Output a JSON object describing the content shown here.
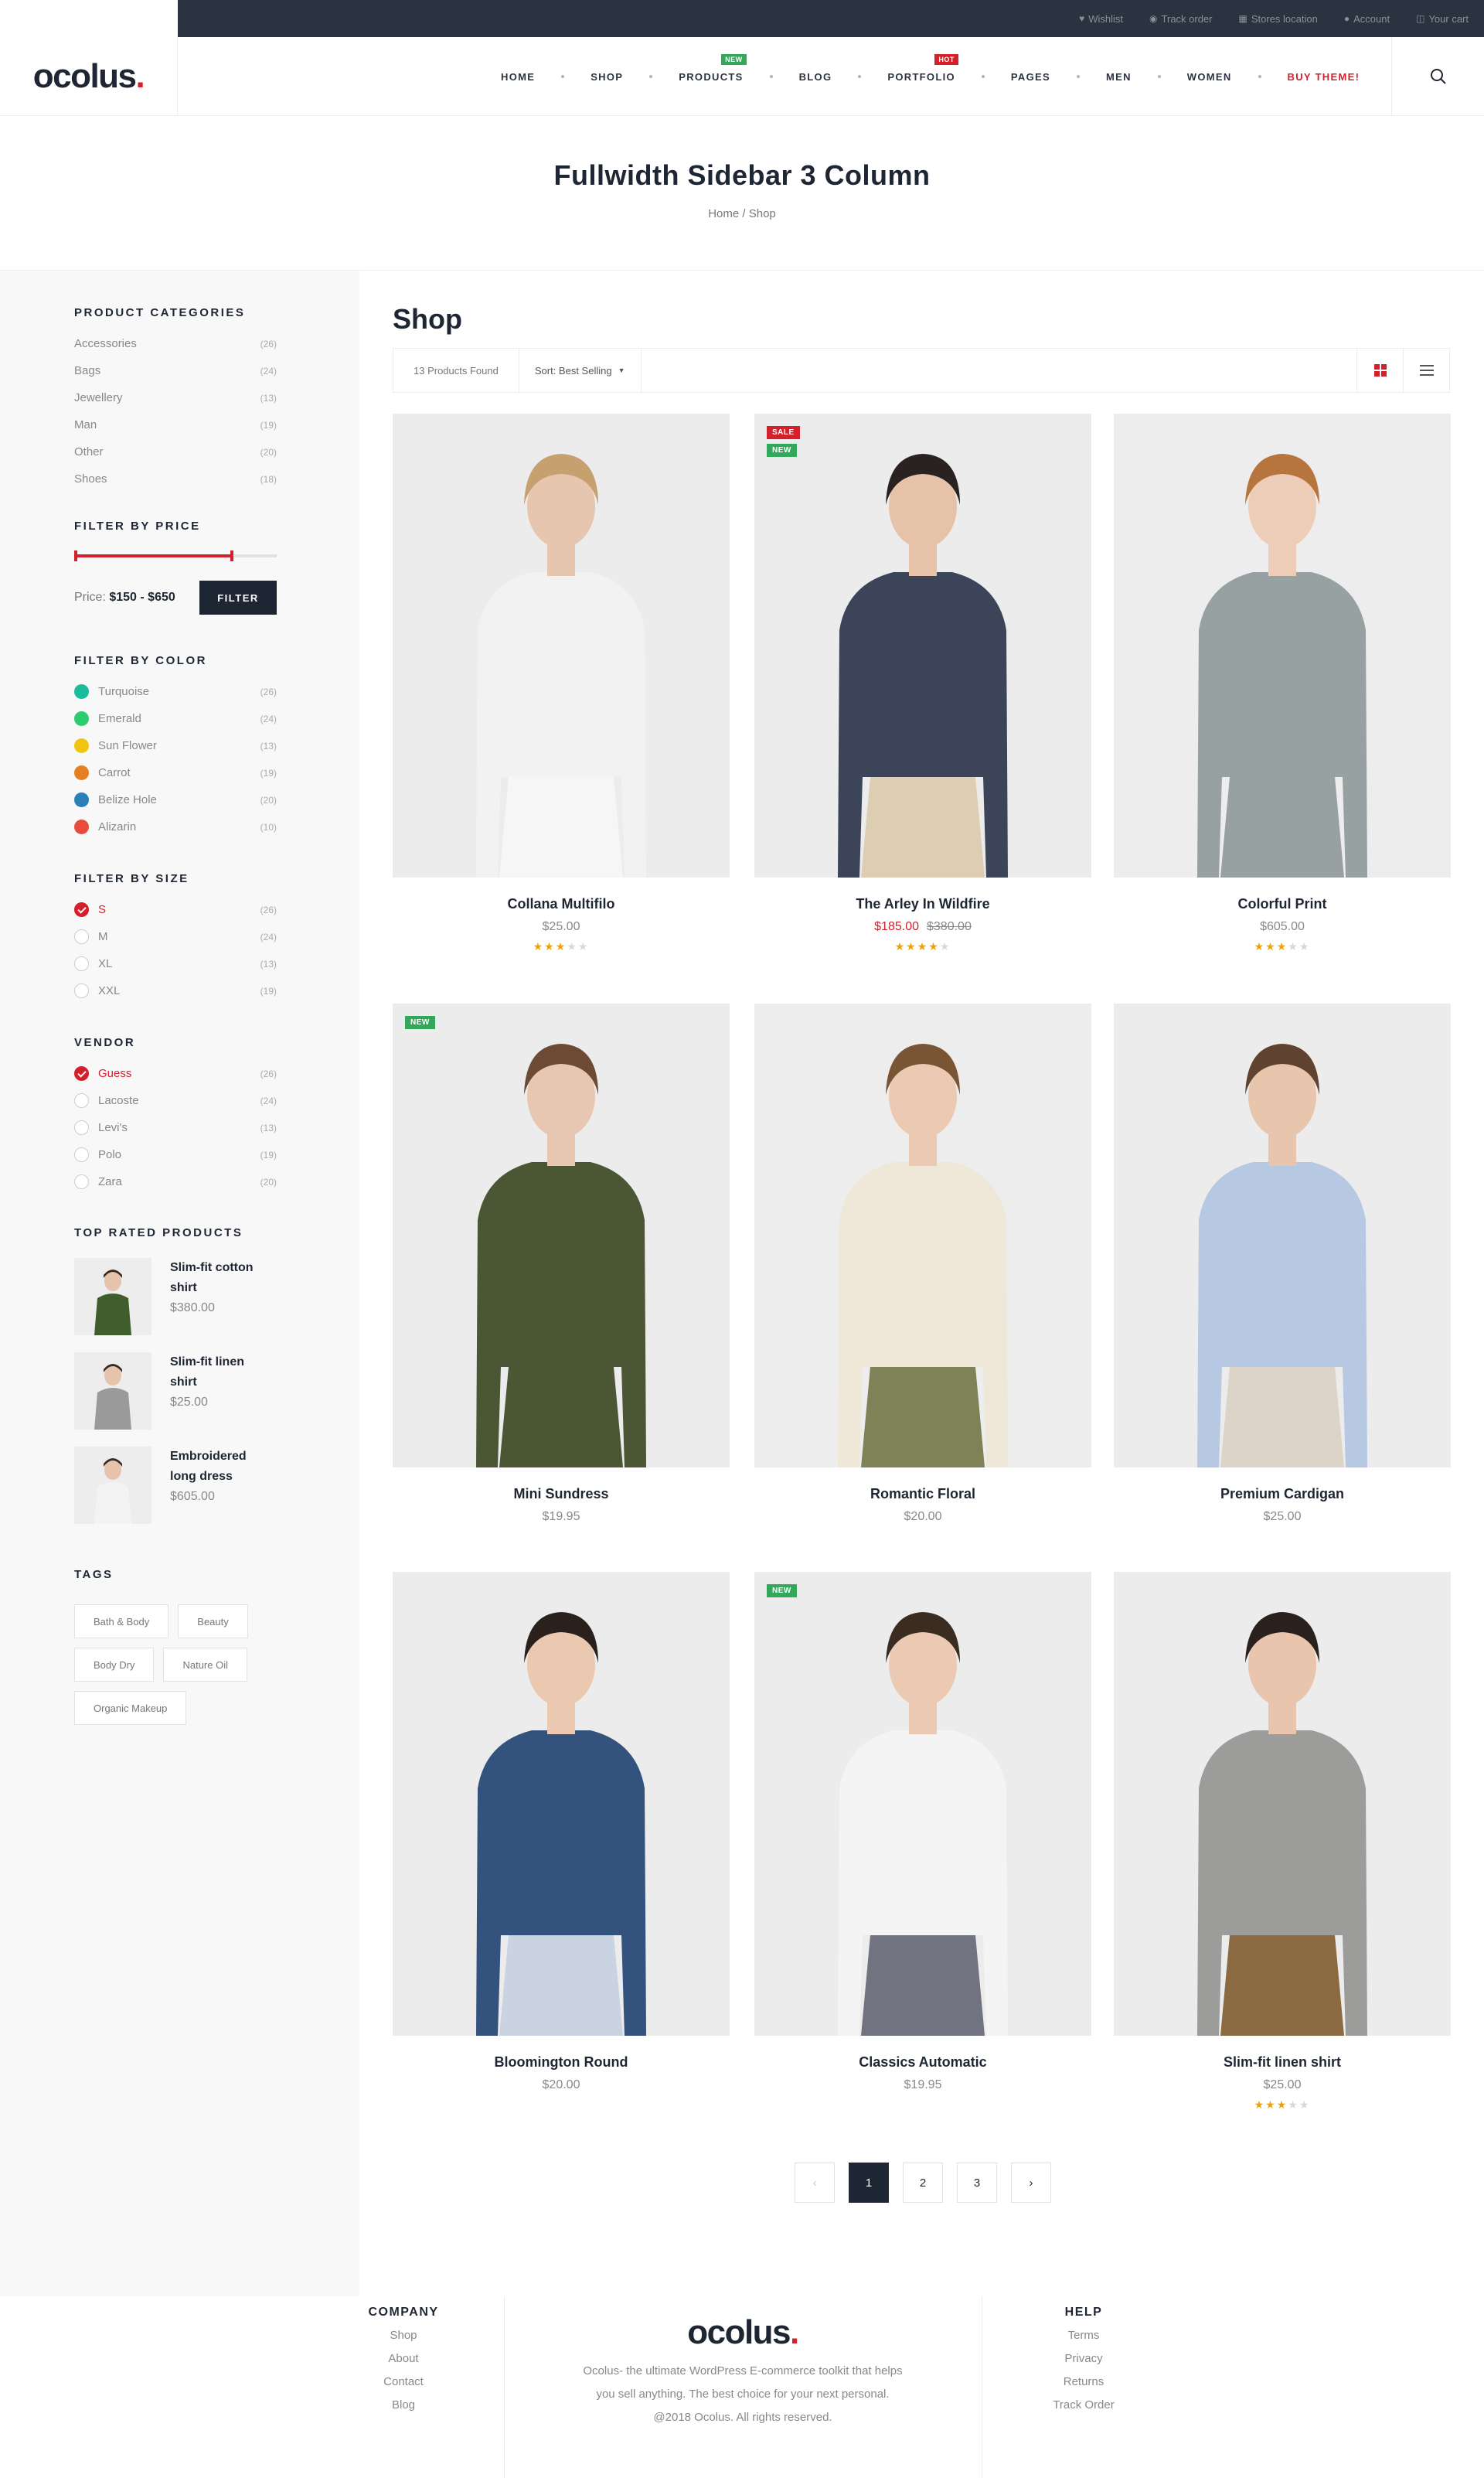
{
  "topbar": {
    "links": [
      {
        "icon": "heart-icon",
        "glyph": "♥",
        "label": "Wishlist"
      },
      {
        "icon": "map-pin-icon",
        "glyph": "◉",
        "label": "Track order"
      },
      {
        "icon": "store-icon",
        "glyph": "▦",
        "label": "Stores location"
      },
      {
        "icon": "user-icon",
        "glyph": "●",
        "label": "Account"
      },
      {
        "icon": "cart-icon",
        "glyph": "◫",
        "label": "Your cart"
      }
    ]
  },
  "header": {
    "logo_text": "ocolus",
    "logo_dot": ".",
    "nav": [
      {
        "label": "HOME"
      },
      {
        "label": "SHOP"
      },
      {
        "label": "PRODUCTS",
        "tag": "NEW"
      },
      {
        "label": "BLOG"
      },
      {
        "label": "PORTFOLIO",
        "tag": "HOT"
      },
      {
        "label": "PAGES"
      },
      {
        "label": "MEN"
      },
      {
        "label": "WOMEN"
      },
      {
        "label": "BUY THEME!"
      }
    ]
  },
  "page_title": {
    "title": "Fullwidth Sidebar 3 Column",
    "breadcrumb_home": "Home",
    "breadcrumb_sep": "/",
    "breadcrumb_current": "Shop"
  },
  "sidebar": {
    "categories_title": "PRODUCT CATEGORIES",
    "categories": [
      {
        "name": "Accessories",
        "count": "(26)"
      },
      {
        "name": "Bags",
        "count": "(24)"
      },
      {
        "name": "Jewellery",
        "count": "(13)"
      },
      {
        "name": "Man",
        "count": "(19)"
      },
      {
        "name": "Other",
        "count": "(20)"
      },
      {
        "name": "Shoes",
        "count": "(18)"
      }
    ],
    "price_title": "FILTER BY PRICE",
    "price_label": "Price:",
    "price_range": "$150 - $650",
    "filter_button": "FILTER",
    "color_title": "FILTER BY COLOR",
    "colors": [
      {
        "name": "Turquoise",
        "count": "(26)",
        "hex": "#1abc9c"
      },
      {
        "name": "Emerald",
        "count": "(24)",
        "hex": "#2ecc71"
      },
      {
        "name": "Sun Flower",
        "count": "(13)",
        "hex": "#f1c40f"
      },
      {
        "name": "Carrot",
        "count": "(19)",
        "hex": "#e67e22"
      },
      {
        "name": "Belize Hole",
        "count": "(20)",
        "hex": "#2980b9"
      },
      {
        "name": "Alizarin",
        "count": "(10)",
        "hex": "#e74c3c"
      }
    ],
    "size_title": "FILTER BY SIZE",
    "sizes": [
      {
        "name": "S",
        "count": "(26)",
        "checked": true
      },
      {
        "name": "M",
        "count": "(24)",
        "checked": false
      },
      {
        "name": "XL",
        "count": "(13)",
        "checked": false
      },
      {
        "name": "XXL",
        "count": "(19)",
        "checked": false
      }
    ],
    "vendor_title": "VENDOR",
    "vendors": [
      {
        "name": "Guess",
        "count": "(26)",
        "checked": true
      },
      {
        "name": "Lacoste",
        "count": "(24)",
        "checked": false
      },
      {
        "name": "Levi's",
        "count": "(13)",
        "checked": false
      },
      {
        "name": "Polo",
        "count": "(19)",
        "checked": false
      },
      {
        "name": "Zara",
        "count": "(20)",
        "checked": false
      }
    ],
    "top_rated_title": "TOP RATED PRODUCTS",
    "top_rated": [
      {
        "name": "Slim-fit cotton shirt",
        "price": "$380.00",
        "color": "#3f5e2c"
      },
      {
        "name": "Slim-fit linen shirt",
        "price": "$25.00",
        "color": "#9a9a9a"
      },
      {
        "name": "Embroidered long dress",
        "price": "$605.00",
        "color": "#f3f3f3"
      }
    ],
    "tags_title": "TAGS",
    "tags": [
      "Bath & Body",
      "Beauty",
      "Body Dry",
      "Nature Oil",
      "Organic Makeup"
    ]
  },
  "main": {
    "heading": "Shop",
    "products_found": "13 Products Found",
    "sort_label": "Sort: Best Selling",
    "products": [
      {
        "name": "Collana Multifilo",
        "price": "$25.00",
        "rating": 3,
        "badges": [],
        "bg": "#ececec",
        "top": "#f2f2f2",
        "bottom": "#f6f6f6",
        "skin": "#e6c6ae",
        "hair": "#c7a070"
      },
      {
        "name": "The Arley In Wildfire",
        "price": "$185.00",
        "old_price": "$380.00",
        "rating": 4,
        "badges": [
          "SALE",
          "NEW"
        ],
        "bg": "#ececec",
        "top": "#3b4458",
        "bottom": "#dccdb3",
        "skin": "#e6c2a8",
        "hair": "#2a2220"
      },
      {
        "name": "Colorful Print",
        "price": "$605.00",
        "rating": 3,
        "badges": [],
        "bg": "#ededed",
        "top": "#98a1a2",
        "bottom": "#98a1a2",
        "skin": "#edcdb8",
        "hair": "#b5753d"
      },
      {
        "name": "Mini Sundress",
        "price": "$19.95",
        "rating": 0,
        "badges": [
          "NEW"
        ],
        "bg": "#ececec",
        "top": "#4b5634",
        "bottom": "#4b5634",
        "skin": "#e8c7b2",
        "hair": "#6c4a33"
      },
      {
        "name": "Romantic Floral",
        "price": "$20.00",
        "rating": 0,
        "badges": [],
        "bg": "#ededed",
        "top": "#efe7d7",
        "bottom": "#7f8157",
        "skin": "#ecc9b2",
        "hair": "#7a5535"
      },
      {
        "name": "Premium Cardigan",
        "price": "$25.00",
        "rating": 0,
        "badges": [],
        "bg": "#ececec",
        "top": "#b7c8e3",
        "bottom": "#dcd4c8",
        "skin": "#e8c6ae",
        "hair": "#5f4330"
      },
      {
        "name": "Bloomington Round",
        "price": "$20.00",
        "rating": 0,
        "badges": [],
        "bg": "#ececec",
        "top": "#33527e",
        "bottom": "#c9d3e1",
        "skin": "#ebc8b0",
        "hair": "#2b211c"
      },
      {
        "name": "Classics Automatic",
        "price": "$19.95",
        "rating": 0,
        "badges": [
          "NEW"
        ],
        "bg": "#ececec",
        "top": "#f4f4f4",
        "bottom": "#717480",
        "skin": "#ecc9b3",
        "hair": "#3b2c22"
      },
      {
        "name": "Slim-fit linen shirt",
        "price": "$25.00",
        "rating": 3,
        "badges": [],
        "bg": "#ececec",
        "top": "#9c9c9a",
        "bottom": "#8b6a42",
        "skin": "#e8c5ac",
        "hair": "#2b211c"
      }
    ],
    "pagination": [
      "‹",
      "1",
      "2",
      "3",
      "›"
    ]
  },
  "footer": {
    "company_title": "COMPANY",
    "company_links": [
      "Shop",
      "About",
      "Contact",
      "Blog"
    ],
    "logo_text": "ocolus",
    "logo_dot": ".",
    "desc_line1": "Ocolus- the ultimate WordPress E-commerce toolkit that helps",
    "desc_line2": "you sell anything. The best choice for your next personal.",
    "copyright": "@2018 Ocolus. All rights reserved.",
    "help_title": "HELP",
    "help_links": [
      "Terms",
      "Privacy",
      "Returns",
      "Track Order"
    ]
  },
  "colors": {
    "accent": "#d3202b",
    "dark": "#1f2633",
    "topbar": "#2b3240",
    "new": "#33a85a",
    "star": "#f2a100"
  }
}
